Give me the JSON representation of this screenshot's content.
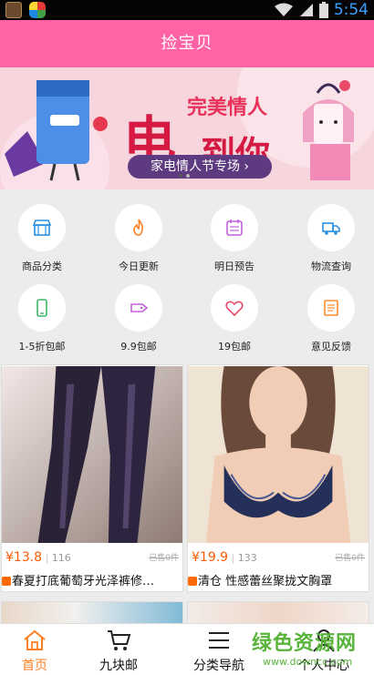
{
  "status_bar": {
    "time": "5:54"
  },
  "header": {
    "title": "捡宝贝"
  },
  "banner": {
    "line1": "完美情人",
    "line2": "电",
    "line3": "到你",
    "subtitle": "家电情人节专场 ›"
  },
  "categories": [
    {
      "label": "商品分类",
      "icon": "store-icon",
      "color": "#2b8fe0"
    },
    {
      "label": "今日更新",
      "icon": "flame-icon",
      "color": "#ff7f23"
    },
    {
      "label": "明日预告",
      "icon": "calendar-icon",
      "color": "#c060d8"
    },
    {
      "label": "物流查询",
      "icon": "truck-icon",
      "color": "#2b8fe0"
    },
    {
      "label": "1-5折包邮",
      "icon": "phone-icon",
      "color": "#3fb56a"
    },
    {
      "label": "9.9包邮",
      "icon": "tag-icon",
      "color": "#c060d8"
    },
    {
      "label": "19包邮",
      "icon": "heart-icon",
      "color": "#e84a6a"
    },
    {
      "label": "意见反馈",
      "icon": "note-icon",
      "color": "#ff8c2a"
    }
  ],
  "products": [
    {
      "price": "¥13.8",
      "count": "116",
      "sold": "已售0件",
      "name": "春夏打底葡萄牙光泽裤修…"
    },
    {
      "price": "¥19.9",
      "count": "133",
      "sold": "已售0件",
      "name": "清仓 性感蕾丝聚拢文胸罩"
    }
  ],
  "bottom_nav": [
    {
      "label": "首页",
      "icon": "home-icon"
    },
    {
      "label": "九块邮",
      "icon": "cart-icon"
    },
    {
      "label": "分类导航",
      "icon": "menu-icon"
    },
    {
      "label": "个人中心",
      "icon": "person-icon"
    }
  ],
  "watermark": {
    "title": "绿色资源网",
    "url": "www.downcc.com"
  },
  "colors": {
    "header": "#ff63a5",
    "accent": "#ff7f23",
    "price": "#ff5a00"
  }
}
